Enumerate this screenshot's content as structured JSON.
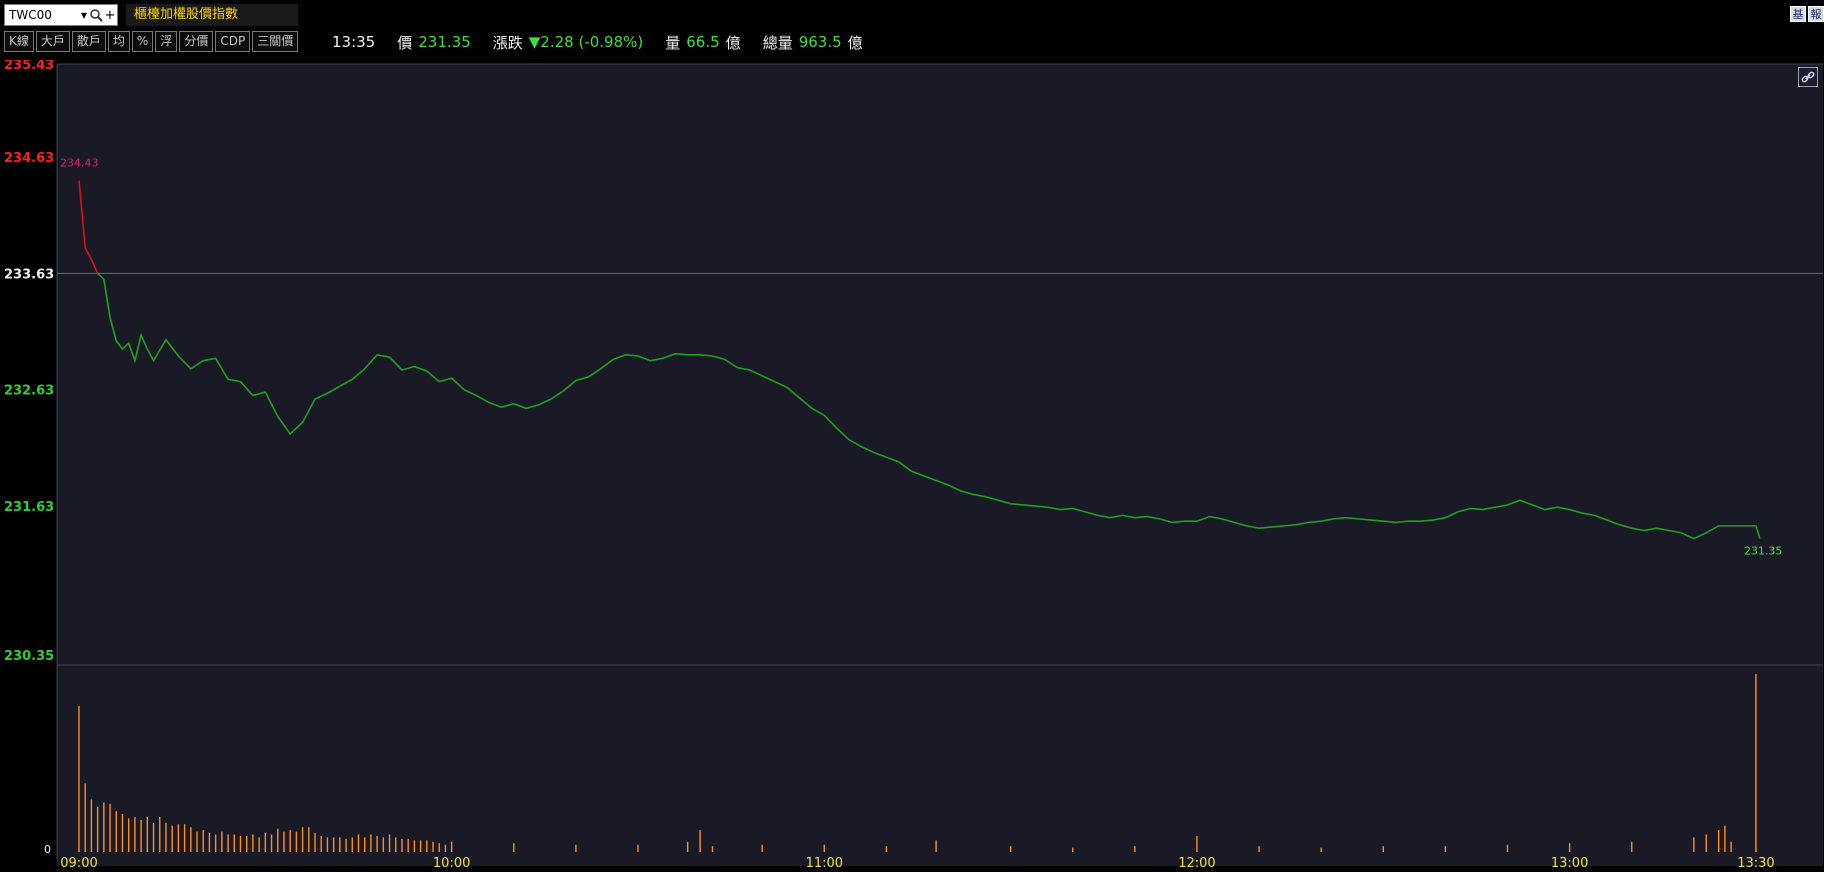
{
  "topbar": {
    "symbol": "TWC00",
    "index_name": "櫃檯加權股價指數",
    "corner_buttons": [
      "基",
      "報"
    ]
  },
  "toolbar": {
    "buttons": [
      "K線",
      "大戶",
      "散戶",
      "均",
      "%",
      "浮",
      "分價",
      "CDP",
      "三關價"
    ]
  },
  "quote": {
    "time": "13:35",
    "price_label": "價",
    "price": "231.35",
    "change_label": "漲跌",
    "change": "▼2.28 (-0.98%)",
    "volume_label": "量",
    "volume": "66.5",
    "volume_unit": "億",
    "total_volume_label": "總量",
    "total_volume": "963.5",
    "total_volume_unit": "億"
  },
  "colors": {
    "background": "#000000",
    "plot_background": "#1a1a26",
    "up": "#ff2020",
    "down": "#30d030",
    "line_down": "#20a020",
    "line_up": "#e01010",
    "volume_bar": "#ff9020",
    "reference_line": "#5a7080"
  },
  "chart_data": {
    "type": "line",
    "reference_price": 233.63,
    "y_ticks": [
      "235.43",
      "234.63",
      "233.63",
      "232.63",
      "231.63",
      "230.35"
    ],
    "ylim": [
      230.35,
      235.43
    ],
    "x_ticks": [
      "09:00",
      "10:00",
      "11:00",
      "12:00",
      "13:00",
      "13:30"
    ],
    "open_label": "234.43",
    "last_label": "231.35",
    "volume_ylabel": "0",
    "price_series": [
      [
        "09:00",
        234.43
      ],
      [
        "09:01",
        233.85
      ],
      [
        "09:02",
        233.75
      ],
      [
        "09:03",
        233.63
      ],
      [
        "09:04",
        233.58
      ],
      [
        "09:05",
        233.25
      ],
      [
        "09:06",
        233.05
      ],
      [
        "09:07",
        232.98
      ],
      [
        "09:08",
        233.03
      ],
      [
        "09:09",
        232.88
      ],
      [
        "09:10",
        233.1
      ],
      [
        "09:11",
        232.98
      ],
      [
        "09:12",
        232.88
      ],
      [
        "09:14",
        233.06
      ],
      [
        "09:16",
        232.92
      ],
      [
        "09:18",
        232.81
      ],
      [
        "09:20",
        232.88
      ],
      [
        "09:22",
        232.9
      ],
      [
        "09:24",
        232.72
      ],
      [
        "09:26",
        232.7
      ],
      [
        "09:28",
        232.58
      ],
      [
        "09:30",
        232.61
      ],
      [
        "09:32",
        232.4
      ],
      [
        "09:34",
        232.25
      ],
      [
        "09:36",
        232.35
      ],
      [
        "09:38",
        232.55
      ],
      [
        "09:40",
        232.6
      ],
      [
        "09:42",
        232.66
      ],
      [
        "09:44",
        232.72
      ],
      [
        "09:46",
        232.81
      ],
      [
        "09:48",
        232.93
      ],
      [
        "09:50",
        232.91
      ],
      [
        "09:52",
        232.8
      ],
      [
        "09:54",
        232.83
      ],
      [
        "09:56",
        232.79
      ],
      [
        "09:58",
        232.7
      ],
      [
        "10:00",
        232.73
      ],
      [
        "10:02",
        232.63
      ],
      [
        "10:04",
        232.58
      ],
      [
        "10:06",
        232.52
      ],
      [
        "10:08",
        232.48
      ],
      [
        "10:10",
        232.51
      ],
      [
        "10:12",
        232.47
      ],
      [
        "10:14",
        232.5
      ],
      [
        "10:16",
        232.55
      ],
      [
        "10:18",
        232.62
      ],
      [
        "10:20",
        232.71
      ],
      [
        "10:22",
        232.74
      ],
      [
        "10:24",
        232.81
      ],
      [
        "10:26",
        232.89
      ],
      [
        "10:28",
        232.93
      ],
      [
        "10:30",
        232.92
      ],
      [
        "10:32",
        232.88
      ],
      [
        "10:34",
        232.9
      ],
      [
        "10:36",
        232.94
      ],
      [
        "10:38",
        232.93
      ],
      [
        "10:40",
        232.93
      ],
      [
        "10:42",
        232.92
      ],
      [
        "10:44",
        232.89
      ],
      [
        "10:46",
        232.82
      ],
      [
        "10:48",
        232.8
      ],
      [
        "10:50",
        232.75
      ],
      [
        "10:52",
        232.7
      ],
      [
        "10:54",
        232.65
      ],
      [
        "10:56",
        232.56
      ],
      [
        "10:58",
        232.47
      ],
      [
        "11:00",
        232.41
      ],
      [
        "11:02",
        232.3
      ],
      [
        "11:04",
        232.2
      ],
      [
        "11:06",
        232.14
      ],
      [
        "11:08",
        232.09
      ],
      [
        "11:10",
        232.05
      ],
      [
        "11:12",
        232.01
      ],
      [
        "11:14",
        231.93
      ],
      [
        "11:16",
        231.89
      ],
      [
        "11:18",
        231.85
      ],
      [
        "11:20",
        231.81
      ],
      [
        "11:22",
        231.76
      ],
      [
        "11:24",
        231.73
      ],
      [
        "11:26",
        231.71
      ],
      [
        "11:28",
        231.68
      ],
      [
        "11:30",
        231.65
      ],
      [
        "11:32",
        231.64
      ],
      [
        "11:34",
        231.63
      ],
      [
        "11:36",
        231.62
      ],
      [
        "11:38",
        231.6
      ],
      [
        "11:40",
        231.61
      ],
      [
        "11:42",
        231.58
      ],
      [
        "11:44",
        231.55
      ],
      [
        "11:46",
        231.53
      ],
      [
        "11:48",
        231.55
      ],
      [
        "11:50",
        231.53
      ],
      [
        "11:52",
        231.54
      ],
      [
        "11:54",
        231.52
      ],
      [
        "11:56",
        231.49
      ],
      [
        "11:58",
        231.5
      ],
      [
        "12:00",
        231.5
      ],
      [
        "12:02",
        231.54
      ],
      [
        "12:04",
        231.52
      ],
      [
        "12:06",
        231.49
      ],
      [
        "12:08",
        231.46
      ],
      [
        "12:10",
        231.44
      ],
      [
        "12:12",
        231.45
      ],
      [
        "12:14",
        231.46
      ],
      [
        "12:16",
        231.47
      ],
      [
        "12:18",
        231.49
      ],
      [
        "12:20",
        231.5
      ],
      [
        "12:22",
        231.52
      ],
      [
        "12:24",
        231.53
      ],
      [
        "12:26",
        231.52
      ],
      [
        "12:28",
        231.51
      ],
      [
        "12:30",
        231.5
      ],
      [
        "12:32",
        231.49
      ],
      [
        "12:34",
        231.5
      ],
      [
        "12:36",
        231.5
      ],
      [
        "12:38",
        231.51
      ],
      [
        "12:40",
        231.53
      ],
      [
        "12:42",
        231.58
      ],
      [
        "12:44",
        231.61
      ],
      [
        "12:46",
        231.6
      ],
      [
        "12:48",
        231.62
      ],
      [
        "12:50",
        231.64
      ],
      [
        "12:52",
        231.68
      ],
      [
        "12:54",
        231.64
      ],
      [
        "12:56",
        231.6
      ],
      [
        "12:58",
        231.62
      ],
      [
        "13:00",
        231.6
      ],
      [
        "13:02",
        231.57
      ],
      [
        "13:04",
        231.55
      ],
      [
        "13:06",
        231.51
      ],
      [
        "13:08",
        231.47
      ],
      [
        "13:10",
        231.44
      ],
      [
        "13:12",
        231.42
      ],
      [
        "13:14",
        231.44
      ],
      [
        "13:16",
        231.42
      ],
      [
        "13:18",
        231.4
      ],
      [
        "13:20",
        231.35
      ],
      [
        "13:22",
        231.4
      ],
      [
        "13:24",
        231.46
      ],
      [
        "13:26",
        231.46
      ],
      [
        "13:28",
        231.46
      ],
      [
        "13:30",
        231.46
      ],
      [
        "13:30",
        231.35
      ]
    ],
    "volume_series": [
      [
        "09:00",
        1.0
      ],
      [
        "09:01",
        0.47
      ],
      [
        "09:02",
        0.36
      ],
      [
        "09:03",
        0.31
      ],
      [
        "09:04",
        0.34
      ],
      [
        "09:05",
        0.33
      ],
      [
        "09:06",
        0.28
      ],
      [
        "09:07",
        0.26
      ],
      [
        "09:08",
        0.23
      ],
      [
        "09:09",
        0.24
      ],
      [
        "09:10",
        0.22
      ],
      [
        "09:11",
        0.24
      ],
      [
        "09:12",
        0.2
      ],
      [
        "09:13",
        0.24
      ],
      [
        "09:14",
        0.2
      ],
      [
        "09:15",
        0.18
      ],
      [
        "09:16",
        0.19
      ],
      [
        "09:17",
        0.19
      ],
      [
        "09:18",
        0.17
      ],
      [
        "09:19",
        0.14
      ],
      [
        "09:20",
        0.15
      ],
      [
        "09:21",
        0.13
      ],
      [
        "09:22",
        0.12
      ],
      [
        "09:23",
        0.14
      ],
      [
        "09:24",
        0.12
      ],
      [
        "09:25",
        0.12
      ],
      [
        "09:26",
        0.11
      ],
      [
        "09:27",
        0.11
      ],
      [
        "09:28",
        0.12
      ],
      [
        "09:29",
        0.1
      ],
      [
        "09:30",
        0.13
      ],
      [
        "09:31",
        0.12
      ],
      [
        "09:32",
        0.16
      ],
      [
        "09:33",
        0.14
      ],
      [
        "09:34",
        0.15
      ],
      [
        "09:35",
        0.14
      ],
      [
        "09:36",
        0.17
      ],
      [
        "09:37",
        0.17
      ],
      [
        "09:38",
        0.13
      ],
      [
        "09:39",
        0.11
      ],
      [
        "09:40",
        0.1
      ],
      [
        "09:41",
        0.1
      ],
      [
        "09:42",
        0.1
      ],
      [
        "09:43",
        0.09
      ],
      [
        "09:44",
        0.1
      ],
      [
        "09:45",
        0.12
      ],
      [
        "09:46",
        0.1
      ],
      [
        "09:47",
        0.12
      ],
      [
        "09:48",
        0.11
      ],
      [
        "09:49",
        0.1
      ],
      [
        "09:50",
        0.12
      ],
      [
        "09:51",
        0.1
      ],
      [
        "09:52",
        0.09
      ],
      [
        "09:53",
        0.09
      ],
      [
        "09:54",
        0.08
      ],
      [
        "09:55",
        0.08
      ],
      [
        "09:56",
        0.08
      ],
      [
        "09:57",
        0.07
      ],
      [
        "09:58",
        0.06
      ],
      [
        "09:59",
        0.05
      ],
      [
        "10:00",
        0.07
      ],
      [
        "10:10",
        0.06
      ],
      [
        "10:20",
        0.05
      ],
      [
        "10:30",
        0.05
      ],
      [
        "10:38",
        0.07
      ],
      [
        "10:40",
        0.15
      ],
      [
        "10:42",
        0.04
      ],
      [
        "10:50",
        0.05
      ],
      [
        "11:00",
        0.05
      ],
      [
        "11:10",
        0.04
      ],
      [
        "11:18",
        0.08
      ],
      [
        "11:30",
        0.04
      ],
      [
        "11:40",
        0.03
      ],
      [
        "11:50",
        0.04
      ],
      [
        "12:00",
        0.11
      ],
      [
        "12:10",
        0.04
      ],
      [
        "12:20",
        0.03
      ],
      [
        "12:30",
        0.04
      ],
      [
        "12:40",
        0.04
      ],
      [
        "12:50",
        0.05
      ],
      [
        "13:00",
        0.06
      ],
      [
        "13:10",
        0.07
      ],
      [
        "13:20",
        0.1
      ],
      [
        "13:22",
        0.12
      ],
      [
        "13:24",
        0.15
      ],
      [
        "13:25",
        0.18
      ],
      [
        "13:26",
        0.07
      ],
      [
        "13:30",
        1.22
      ]
    ]
  }
}
